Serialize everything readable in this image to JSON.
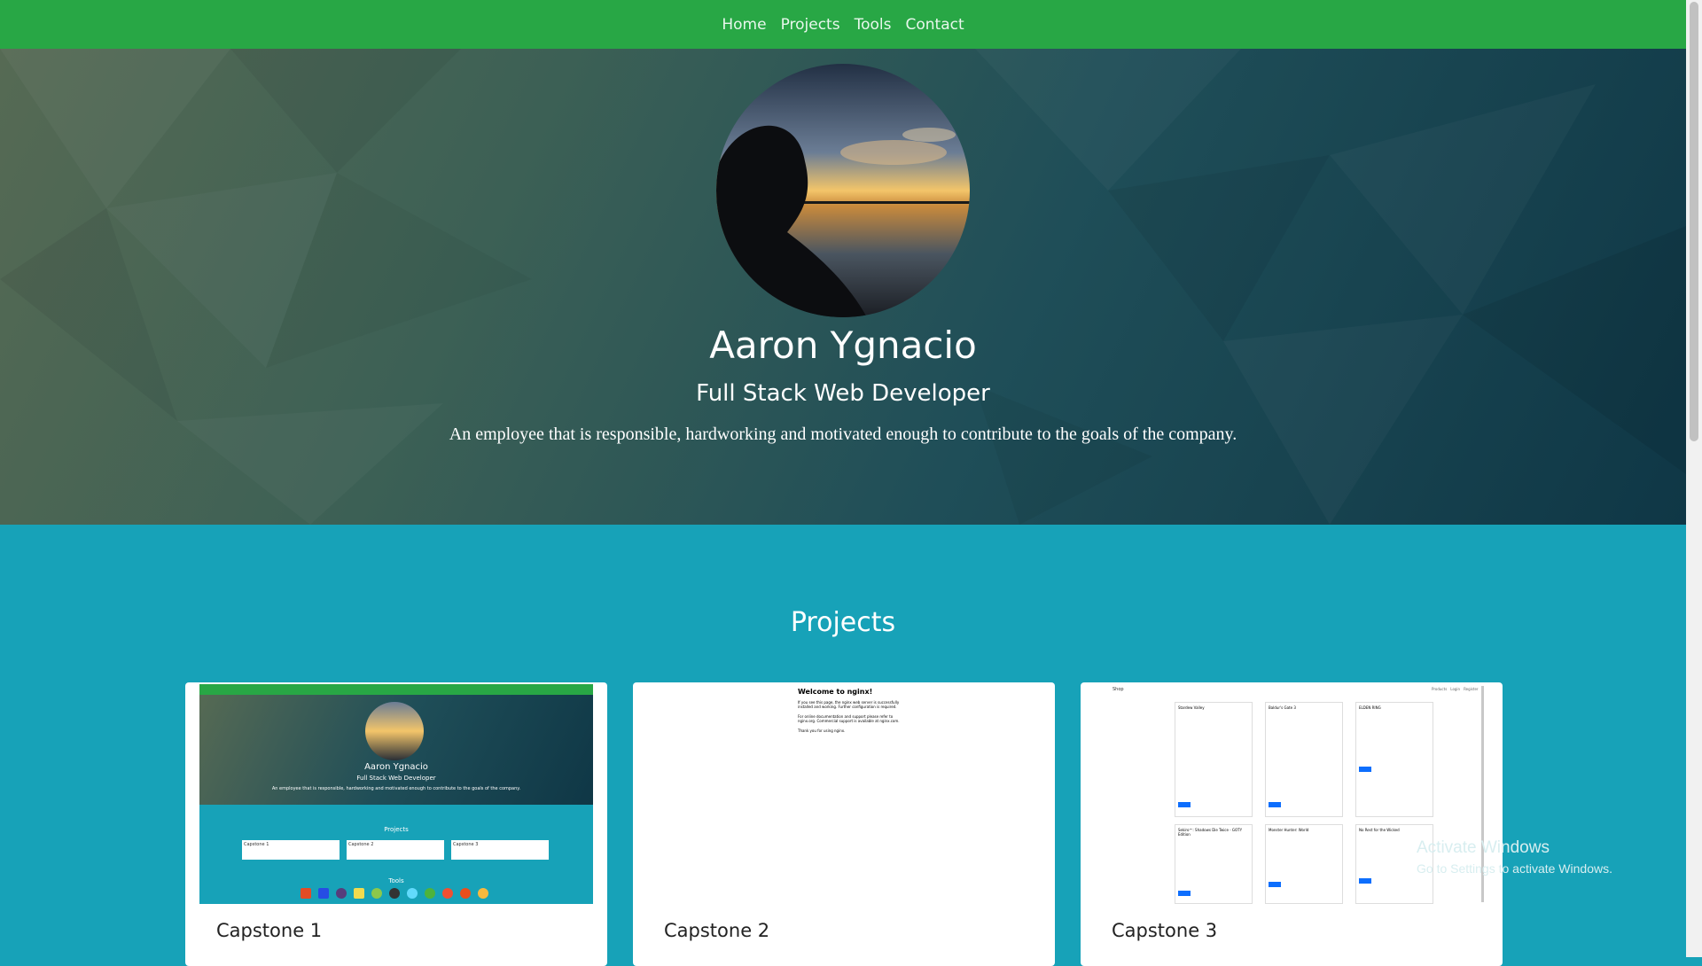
{
  "nav": {
    "items": [
      {
        "label": "Home"
      },
      {
        "label": "Projects"
      },
      {
        "label": "Tools"
      },
      {
        "label": "Contact"
      }
    ]
  },
  "hero": {
    "name": "Aaron Ygnacio",
    "role": "Full Stack Web Developer",
    "description": "An employee that is responsible, hardworking and motivated enough to contribute to the goals of the company."
  },
  "projects": {
    "title": "Projects",
    "cards": [
      {
        "title": "Capstone 1"
      },
      {
        "title": "Capstone 2"
      },
      {
        "title": "Capstone 3"
      }
    ],
    "capstone1_thumb": {
      "name": "Aaron Ygnacio",
      "role": "Full Stack Web Developer",
      "desc": "An employee that is responsible, hardworking and motivated enough to contribute to the goals of the company.",
      "projects_label": "Projects",
      "cards": [
        "Capstone 1",
        "Capstone 2",
        "Capstone 3"
      ],
      "tools_label": "Tools"
    },
    "capstone2_thumb": {
      "heading": "Welcome to nginx!",
      "line1": "If you see this page, the nginx web server is successfully installed and working. Further configuration is required.",
      "line2": "For online documentation and support please refer to nginx.org. Commercial support is available at nginx.com.",
      "line3": "Thank you for using nginx."
    },
    "capstone3_thumb": {
      "brand": "Shop",
      "nav": [
        "Products",
        "Login",
        "Register"
      ],
      "products": [
        "Stardew Valley",
        "Baldur's Gate 3",
        "ELDEN RING",
        "Sekiro™: Shadows Die Twice - GOTY Edition",
        "Monster Hunter: World",
        "No Rest for the Wicked"
      ]
    }
  },
  "watermark": {
    "title": "Activate Windows",
    "subtitle": "Go to Settings to activate Windows."
  },
  "colors": {
    "navbar": "#28a745",
    "projects_bg": "#17a2b8",
    "card": "#ffffff"
  }
}
